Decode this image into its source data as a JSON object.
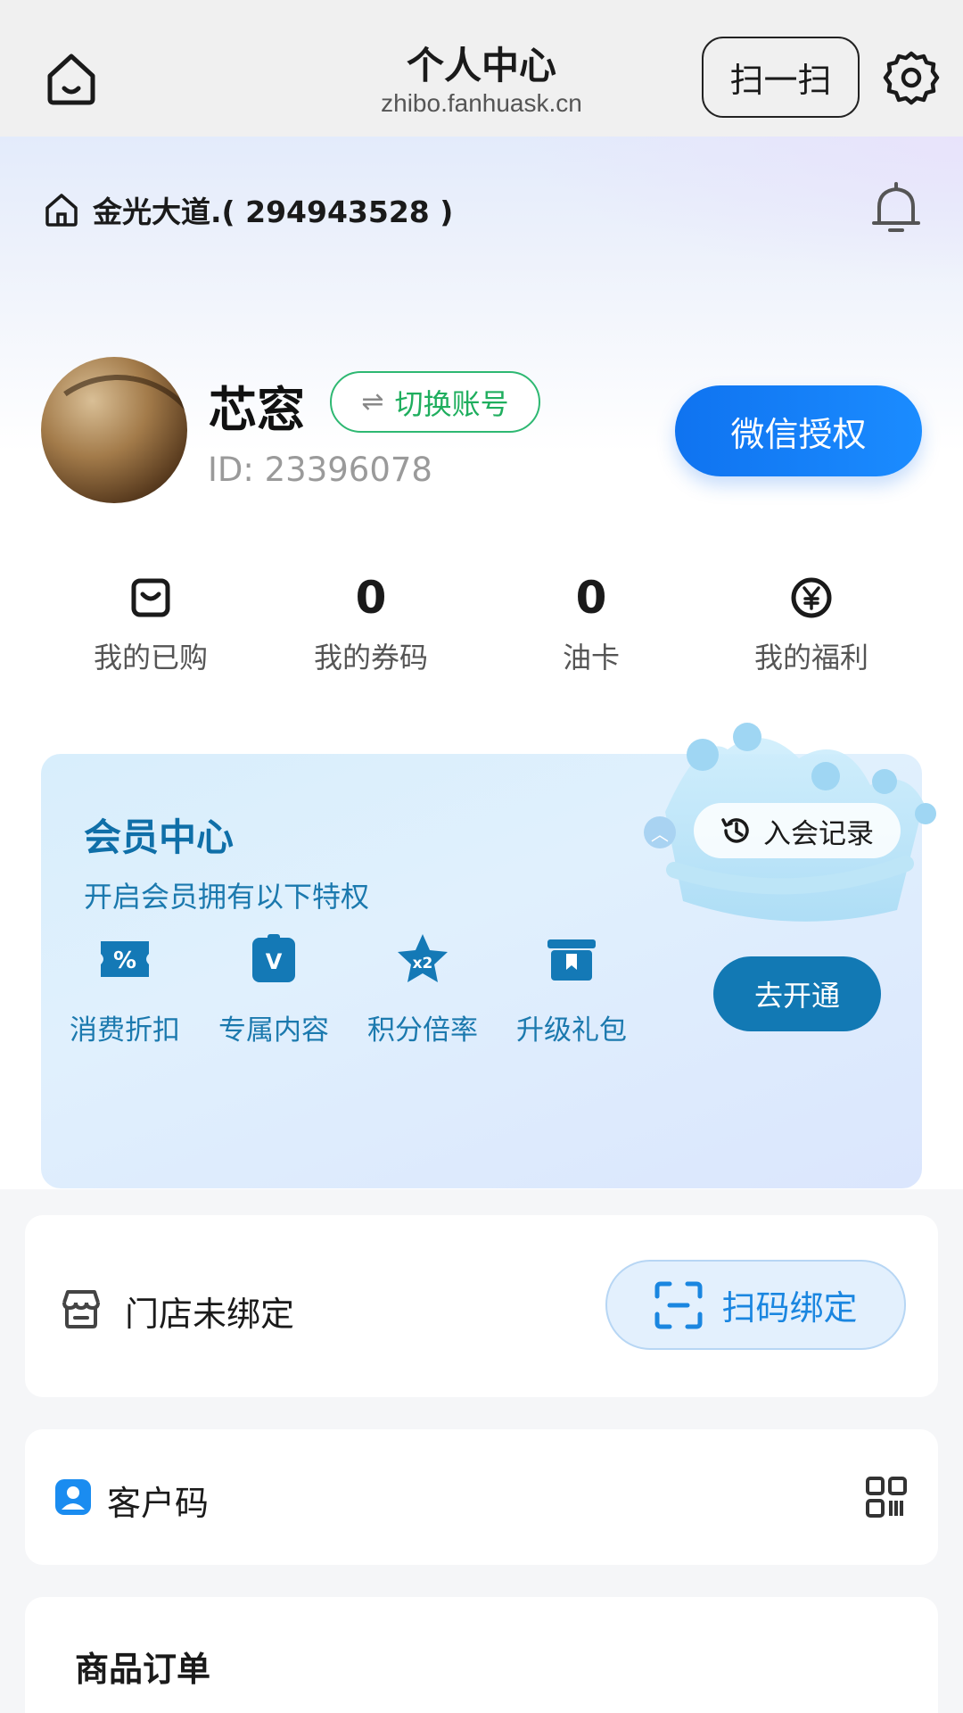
{
  "topbar": {
    "title": "个人中心",
    "url": "zhibo.fanhuask.cn",
    "scan_label": "扫一扫"
  },
  "store": {
    "name": "金光大道.( 294943528 )"
  },
  "profile": {
    "name": "芯窓",
    "switch_label": "切换账号",
    "id_text": "ID: 23396078",
    "wechat_auth_label": "微信授权"
  },
  "stats": [
    {
      "value": "",
      "icon": "bag-icon",
      "label": "我的已购"
    },
    {
      "value": "0",
      "icon": "",
      "label": "我的券码"
    },
    {
      "value": "0",
      "icon": "",
      "label": "油卡"
    },
    {
      "value": "",
      "icon": "yen-circle-icon",
      "label": "我的福利"
    }
  ],
  "member": {
    "title": "会员中心",
    "subtitle": "开启会员拥有以下特权",
    "record_label": "入会记录",
    "open_label": "去开通",
    "perks": [
      {
        "icon": "discount-ticket-icon",
        "label": "消费折扣"
      },
      {
        "icon": "vip-bag-icon",
        "label": "专属内容"
      },
      {
        "icon": "star-x2-icon",
        "label": "积分倍率"
      },
      {
        "icon": "gift-icon",
        "label": "升级礼包"
      }
    ]
  },
  "bind": {
    "status": "门店未绑定",
    "button_label": "扫码绑定"
  },
  "customer": {
    "label": "客户码"
  },
  "orders": {
    "title": "商品订单"
  },
  "colors": {
    "primary_blue": "#1b8cff",
    "member_blue": "#1279b4",
    "green": "#2eb872"
  }
}
